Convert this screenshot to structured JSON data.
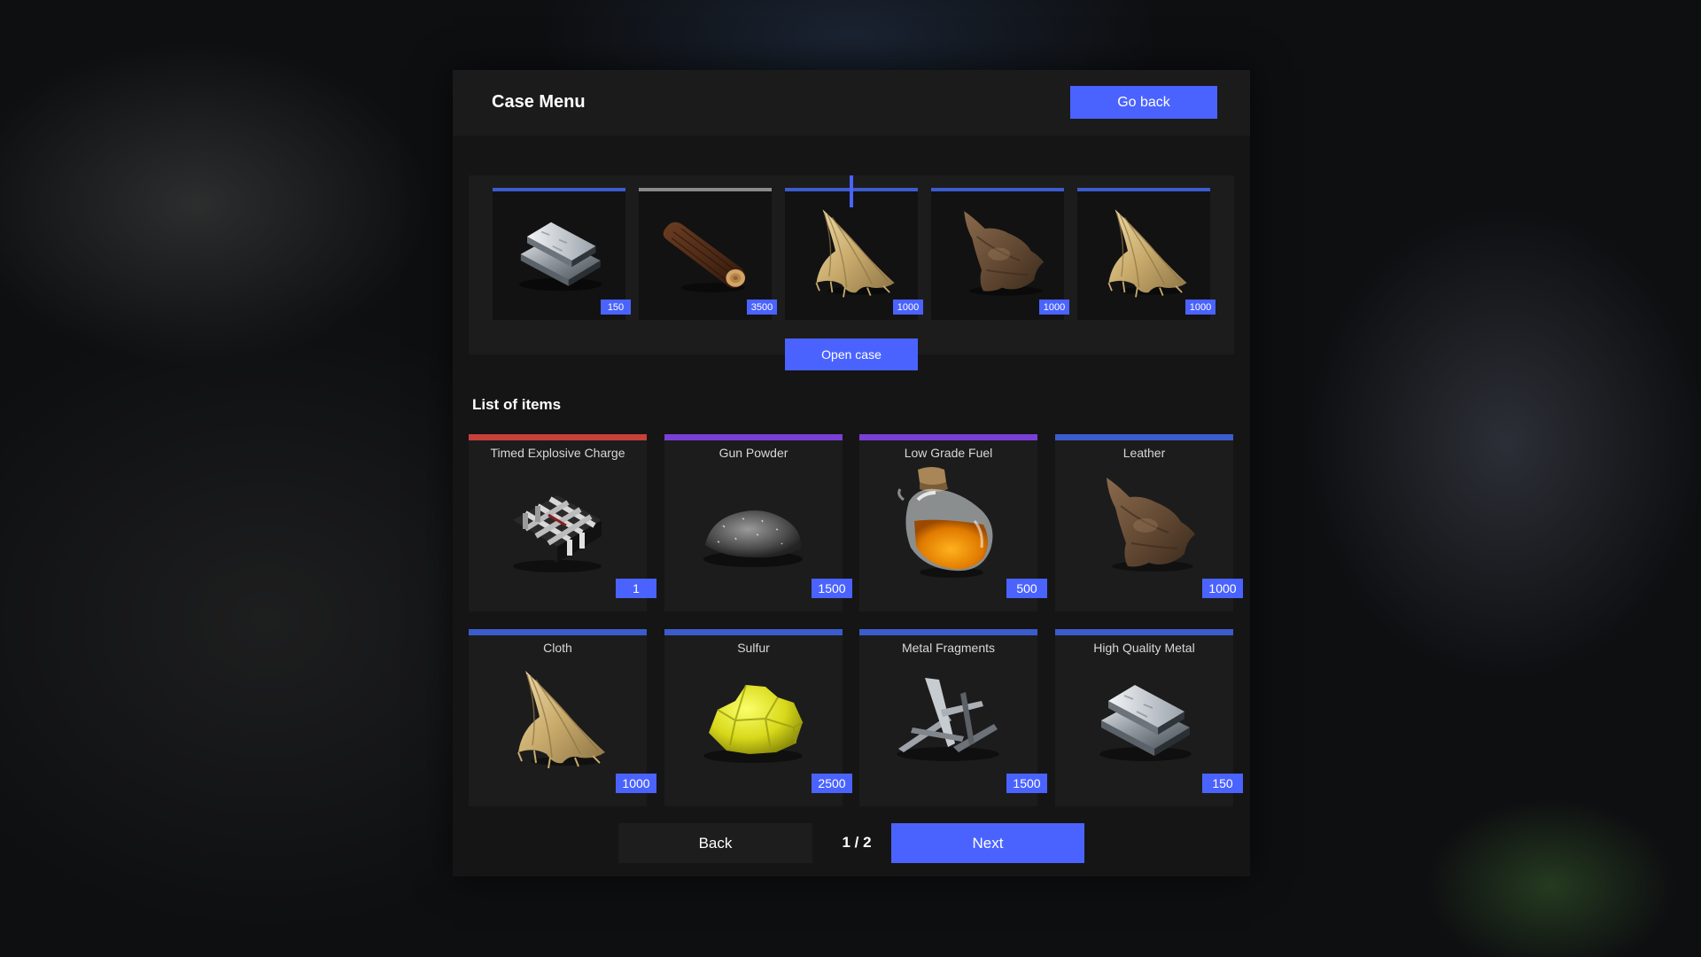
{
  "header": {
    "title": "Case Menu",
    "go_back_label": "Go back"
  },
  "roulette": {
    "items": [
      {
        "icon": "metal-ingot-icon",
        "amount": "150",
        "rarity_color": "#3b5ccc"
      },
      {
        "icon": "wood-log-icon",
        "amount": "3500",
        "rarity_color": "#8a8a8a"
      },
      {
        "icon": "cloth-icon",
        "amount": "1000",
        "rarity_color": "#3b5ccc"
      },
      {
        "icon": "leather-icon",
        "amount": "1000",
        "rarity_color": "#3b5ccc"
      },
      {
        "icon": "cloth-icon",
        "amount": "1000",
        "rarity_color": "#3b5ccc"
      }
    ],
    "marker_color": "#4a63ff"
  },
  "open_case_label": "Open case",
  "list": {
    "title": "List of items",
    "items": [
      {
        "name": "Timed Explosive Charge",
        "amount": "1",
        "icon": "explosive-charge-icon",
        "rarity_color": "#c8403a"
      },
      {
        "name": "Gun Powder",
        "amount": "1500",
        "icon": "gun-powder-icon",
        "rarity_color": "#7a3fd6"
      },
      {
        "name": "Low Grade Fuel",
        "amount": "500",
        "icon": "fuel-jar-icon",
        "rarity_color": "#7a3fd6"
      },
      {
        "name": "Leather",
        "amount": "1000",
        "icon": "leather-icon",
        "rarity_color": "#3b5ccc"
      },
      {
        "name": "Cloth",
        "amount": "1000",
        "icon": "cloth-icon",
        "rarity_color": "#3b5ccc"
      },
      {
        "name": "Sulfur",
        "amount": "2500",
        "icon": "sulfur-icon",
        "rarity_color": "#3b5ccc"
      },
      {
        "name": "Metal Fragments",
        "amount": "1500",
        "icon": "metal-fragments-icon",
        "rarity_color": "#3b5ccc"
      },
      {
        "name": "High Quality Metal",
        "amount": "150",
        "icon": "metal-ingot-icon",
        "rarity_color": "#3b5ccc"
      }
    ]
  },
  "pagination": {
    "back_label": "Back",
    "page_label": "1 / 2",
    "next_label": "Next"
  },
  "colors": {
    "accent": "#4a63ff",
    "panel": "#151515",
    "card": "#1c1c1c"
  }
}
